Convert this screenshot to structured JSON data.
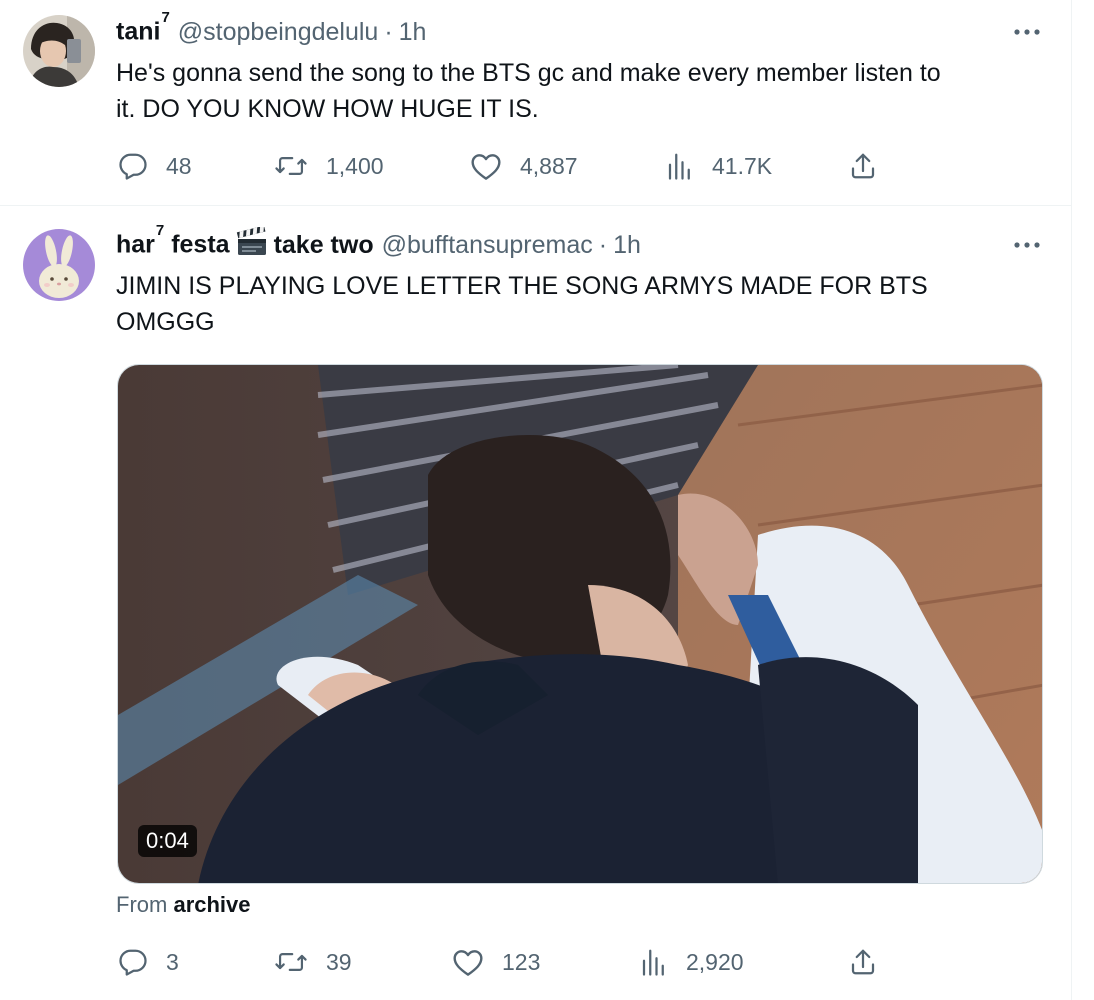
{
  "tweets": [
    {
      "display_name": "tani",
      "name_superscript": "7",
      "handle": "@stopbeingdelulu",
      "separator": "·",
      "time": "1h",
      "text": "He's gonna send the song to the BTS gc and make every member listen to\nit. DO YOU KNOW HOW HUGE IT IS.",
      "replies": "48",
      "retweets": "1,400",
      "likes": "4,887",
      "views": "41.7K"
    },
    {
      "display_name": "har",
      "name_superscript": "7",
      "display_name_rest_1": "festa",
      "display_name_emoji": "clapper-board-icon",
      "display_name_rest_2": "take two",
      "handle": "@bufftansupremac",
      "separator": "·",
      "time": "1h",
      "text": "JIMIN IS PLAYING LOVE LETTER THE SONG ARMYS MADE FOR BTS\nOMGGG",
      "video_duration": "0:04",
      "from_prefix": "From",
      "from_source": "archive",
      "replies": "3",
      "retweets": "39",
      "likes": "123",
      "views": "2,920"
    }
  ],
  "icons": {
    "reply": "reply-icon",
    "retweet": "retweet-icon",
    "like": "heart-icon",
    "views": "views-icon",
    "share": "share-icon",
    "more": "more-icon"
  },
  "colors": {
    "text_primary": "#0f1419",
    "text_secondary": "#536471",
    "divider": "#eff3f4"
  }
}
